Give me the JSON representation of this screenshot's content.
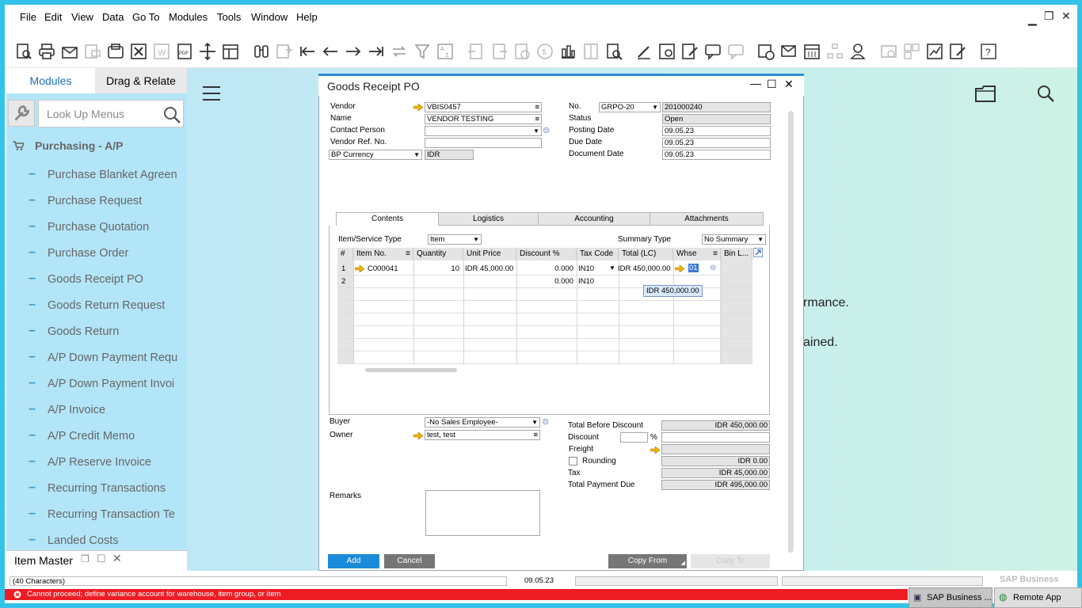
{
  "menu": [
    "File",
    "Edit",
    "View",
    "Data",
    "Go To",
    "Modules",
    "Tools",
    "Window",
    "Help"
  ],
  "left_panel": {
    "tabs": {
      "modules": "Modules",
      "drag_relate": "Drag & Relate"
    },
    "search_placeholder": "Look Up Menus",
    "section": "Purchasing - A/P",
    "items": [
      "Purchase Blanket Agreen",
      "Purchase Request",
      "Purchase Quotation",
      "Purchase Order",
      "Goods Receipt PO",
      "Goods Return Request",
      "Goods Return",
      "A/P Down Payment Requ",
      "A/P Down Payment Invoi",
      "A/P Invoice",
      "A/P Credit Memo",
      "A/P Reserve Invoice",
      "Recurring Transactions",
      "Recurring Transaction Te",
      "Landed Costs"
    ],
    "bottom_tab": "Item Master"
  },
  "background_text": {
    "line1": "rmance.",
    "line2": "ained."
  },
  "dialog": {
    "title": "Goods Receipt PO",
    "header_left": {
      "vendor_label": "Vendor",
      "vendor": "VBIS0457",
      "name_label": "Name",
      "name": "VENDOR TESTING",
      "contact_label": "Contact Person",
      "contact": "",
      "vendor_ref_label": "Vendor Ref. No.",
      "vendor_ref": "",
      "currency_select": "BP Currency",
      "currency": "IDR"
    },
    "header_right": {
      "no_label": "No.",
      "series": "GRPO-20",
      "number": "201000240",
      "status_label": "Status",
      "status": "Open",
      "posting_label": "Posting Date",
      "posting": "09.05.23",
      "due_label": "Due Date",
      "due": "09.05.23",
      "docdate_label": "Document Date",
      "docdate": "09.05.23"
    },
    "tabs": [
      "Contents",
      "Logistics",
      "Accounting",
      "Attachments"
    ],
    "item_type_label": "Item/Service Type",
    "item_type": "Item",
    "summary_type_label": "Summary Type",
    "summary_type": "No Summary",
    "columns": [
      "#",
      "Item No.",
      "Quantity",
      "Unit Price",
      "Discount %",
      "Tax Code",
      "Total (LC)",
      "Whse",
      "Bin L..."
    ],
    "rows": [
      {
        "num": "1",
        "item": "C000041",
        "qty": "10",
        "price": "IDR 45,000.00",
        "disc": "0.000",
        "tax": "IN10",
        "total": "IDR 450,000.00",
        "whse": "01"
      },
      {
        "num": "2",
        "item": "",
        "qty": "",
        "price": "",
        "disc": "0.000",
        "tax": "IN10",
        "total": "",
        "whse": ""
      }
    ],
    "tooltip": "IDR 450,000.00",
    "footer_left": {
      "buyer_label": "Buyer",
      "buyer": "-No Sales Employee-",
      "owner_label": "Owner",
      "owner": "test, test",
      "remarks_label": "Remarks"
    },
    "totals": {
      "before_label": "Total Before Discount",
      "before": "IDR 450,000.00",
      "discount_label": "Discount",
      "discount_pct": "",
      "pct_sign": "%",
      "discount_amt": "",
      "freight_label": "Freight",
      "freight": "",
      "rounding_label": "Rounding",
      "rounding": "IDR 0.00",
      "tax_label": "Tax",
      "tax": "IDR 45,000.00",
      "total_label": "Total Payment Due",
      "total": "IDR 495,000.00"
    },
    "buttons": {
      "add": "Add",
      "cancel": "Cancel",
      "copy_from": "Copy From",
      "copy_to": "Copy To"
    }
  },
  "status": {
    "chars": "(40 Characters)",
    "date": "09.05.23",
    "error": "Cannot proceed; define variance account for warehouse, item group, or item",
    "sap": "SAP Business"
  },
  "taskbar": {
    "sap": "SAP Business ...",
    "remote": "Remote App"
  },
  "colors": {
    "accent": "#34c3e8",
    "primary_button": "#1b8ad8",
    "error": "#ee1c25"
  }
}
